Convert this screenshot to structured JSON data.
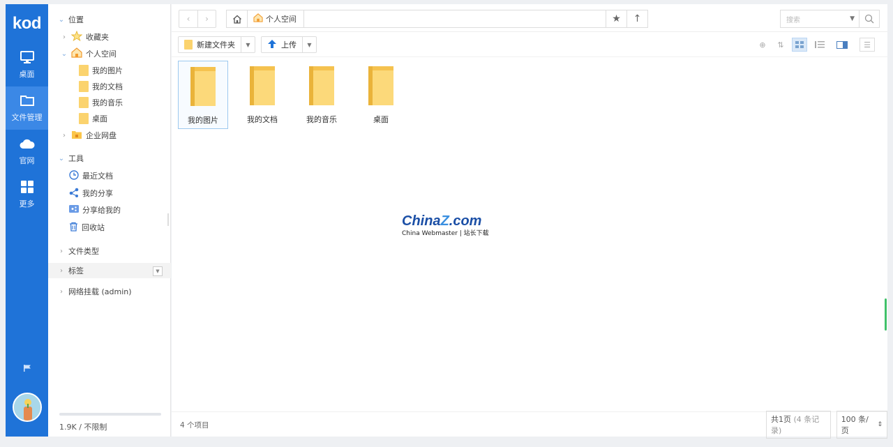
{
  "app": {
    "logo": "kod"
  },
  "rail": {
    "items": [
      {
        "label": "桌面",
        "icon": "monitor-icon",
        "active": false
      },
      {
        "label": "文件管理",
        "icon": "folder-outline-icon",
        "active": true
      },
      {
        "label": "官网",
        "icon": "cloud-icon",
        "active": false
      },
      {
        "label": "更多",
        "icon": "grid-icon",
        "active": false
      }
    ]
  },
  "sidebar": {
    "location_header": "位置",
    "favorites": "收藏夹",
    "personal_space": "个人空间",
    "children": [
      "我的图片",
      "我的文档",
      "我的音乐",
      "桌面"
    ],
    "enterprise": "企业网盘",
    "tools_header": "工具",
    "tools": [
      {
        "label": "最近文档",
        "icon": "clock-icon"
      },
      {
        "label": "我的分享",
        "icon": "share-icon"
      },
      {
        "label": "分享给我的",
        "icon": "shared-with-me-icon"
      },
      {
        "label": "回收站",
        "icon": "trash-icon"
      }
    ],
    "file_types": "文件类型",
    "tags": "标签",
    "network_mount": "网络挂载 (admin)",
    "quota": "1.9K / 不限制",
    "quota_used_fraction": 0
  },
  "pathbar": {
    "crumb": "个人空间",
    "search_placeholder": "搜索"
  },
  "toolbar": {
    "new_folder": "新建文件夹",
    "upload": "上传"
  },
  "files": [
    {
      "name": "我的图片",
      "selected": true
    },
    {
      "name": "我的文档",
      "selected": false
    },
    {
      "name": "我的音乐",
      "selected": false
    },
    {
      "name": "桌面",
      "selected": false
    }
  ],
  "watermark": {
    "brand_a": "China",
    "brand_z": "Z",
    "brand_b": ".com",
    "sub": "China Webmaster | 站长下载"
  },
  "status": {
    "count": "4 个项目",
    "pages_a": "共1页",
    "pages_b": "(4 条记录)",
    "per_page": "100 条/页"
  },
  "colors": {
    "accent": "#1f73d8",
    "folder": "#fbd36e"
  }
}
